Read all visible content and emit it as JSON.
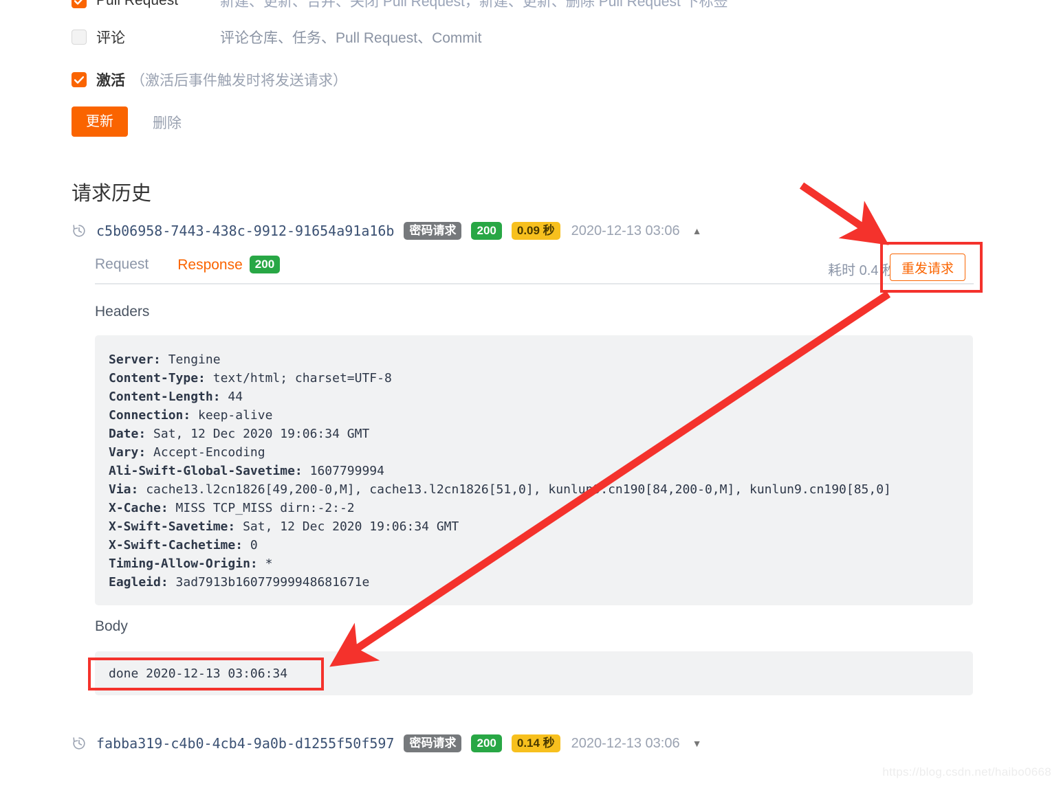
{
  "events": [
    {
      "id": "pull-request",
      "label": "Pull Request",
      "checked": true,
      "description": "新建、更新、合并、关闭 Pull Request，新建、更新、删除 Pull Request 下标签"
    },
    {
      "id": "comment",
      "label": "评论",
      "checked": false,
      "description": "评论仓库、任务、Pull Request、Commit"
    }
  ],
  "active": {
    "label": "激活",
    "checked": true,
    "note": "（激活后事件触发时将发送请求）"
  },
  "actions": {
    "update_label": "更新",
    "delete_label": "删除"
  },
  "history": {
    "title": "请求历史",
    "rows": [
      {
        "uuid": "c5b06958-7443-438c-9912-91654a91a16b",
        "type_badge": "密码请求",
        "status_badge": "200",
        "duration_badge": "0.09 秒",
        "timestamp": "2020-12-13 03:06",
        "caret": "▲",
        "expanded": true
      },
      {
        "uuid": "fabba319-c4b0-4cb4-9a0b-d1255f50f597",
        "type_badge": "密码请求",
        "status_badge": "200",
        "duration_badge": "0.14 秒",
        "timestamp": "2020-12-13 03:06",
        "caret": "▼",
        "expanded": false
      }
    ]
  },
  "detail": {
    "tab_request": "Request",
    "tab_response": "Response",
    "response_status": "200",
    "elapsed": "耗时 0.4 秒",
    "resend_label": "重发请求",
    "headers_label": "Headers",
    "body_label": "Body",
    "headers": [
      {
        "key": "Server:",
        "value": " Tengine"
      },
      {
        "key": "Content-Type:",
        "value": " text/html; charset=UTF-8"
      },
      {
        "key": "Content-Length:",
        "value": " 44"
      },
      {
        "key": "Connection:",
        "value": " keep-alive"
      },
      {
        "key": "Date:",
        "value": " Sat, 12 Dec 2020 19:06:34 GMT"
      },
      {
        "key": "Vary:",
        "value": " Accept-Encoding"
      },
      {
        "key": "Ali-Swift-Global-Savetime:",
        "value": " 1607799994"
      },
      {
        "key": "Via:",
        "value": " cache13.l2cn1826[49,200-0,M], cache13.l2cn1826[51,0], kunlun9.cn190[84,200-0,M], kunlun9.cn190[85,0]"
      },
      {
        "key": "X-Cache:",
        "value": " MISS TCP_MISS dirn:-2:-2"
      },
      {
        "key": "X-Swift-Savetime:",
        "value": " Sat, 12 Dec 2020 19:06:34 GMT"
      },
      {
        "key": "X-Swift-Cachetime:",
        "value": " 0"
      },
      {
        "key": "Timing-Allow-Origin:",
        "value": " *"
      },
      {
        "key": "Eagleid:",
        "value": " 3ad7913b16077999948681671e"
      }
    ],
    "body": "done 2020-12-13 03:06:34"
  },
  "colors": {
    "accent_orange": "#fa6400",
    "badge_green": "#28a745",
    "badge_amber": "#f7c01e",
    "badge_grey": "#76797c",
    "annotation_red": "#f4322c"
  },
  "watermark": "https://blog.csdn.net/haibo0668"
}
